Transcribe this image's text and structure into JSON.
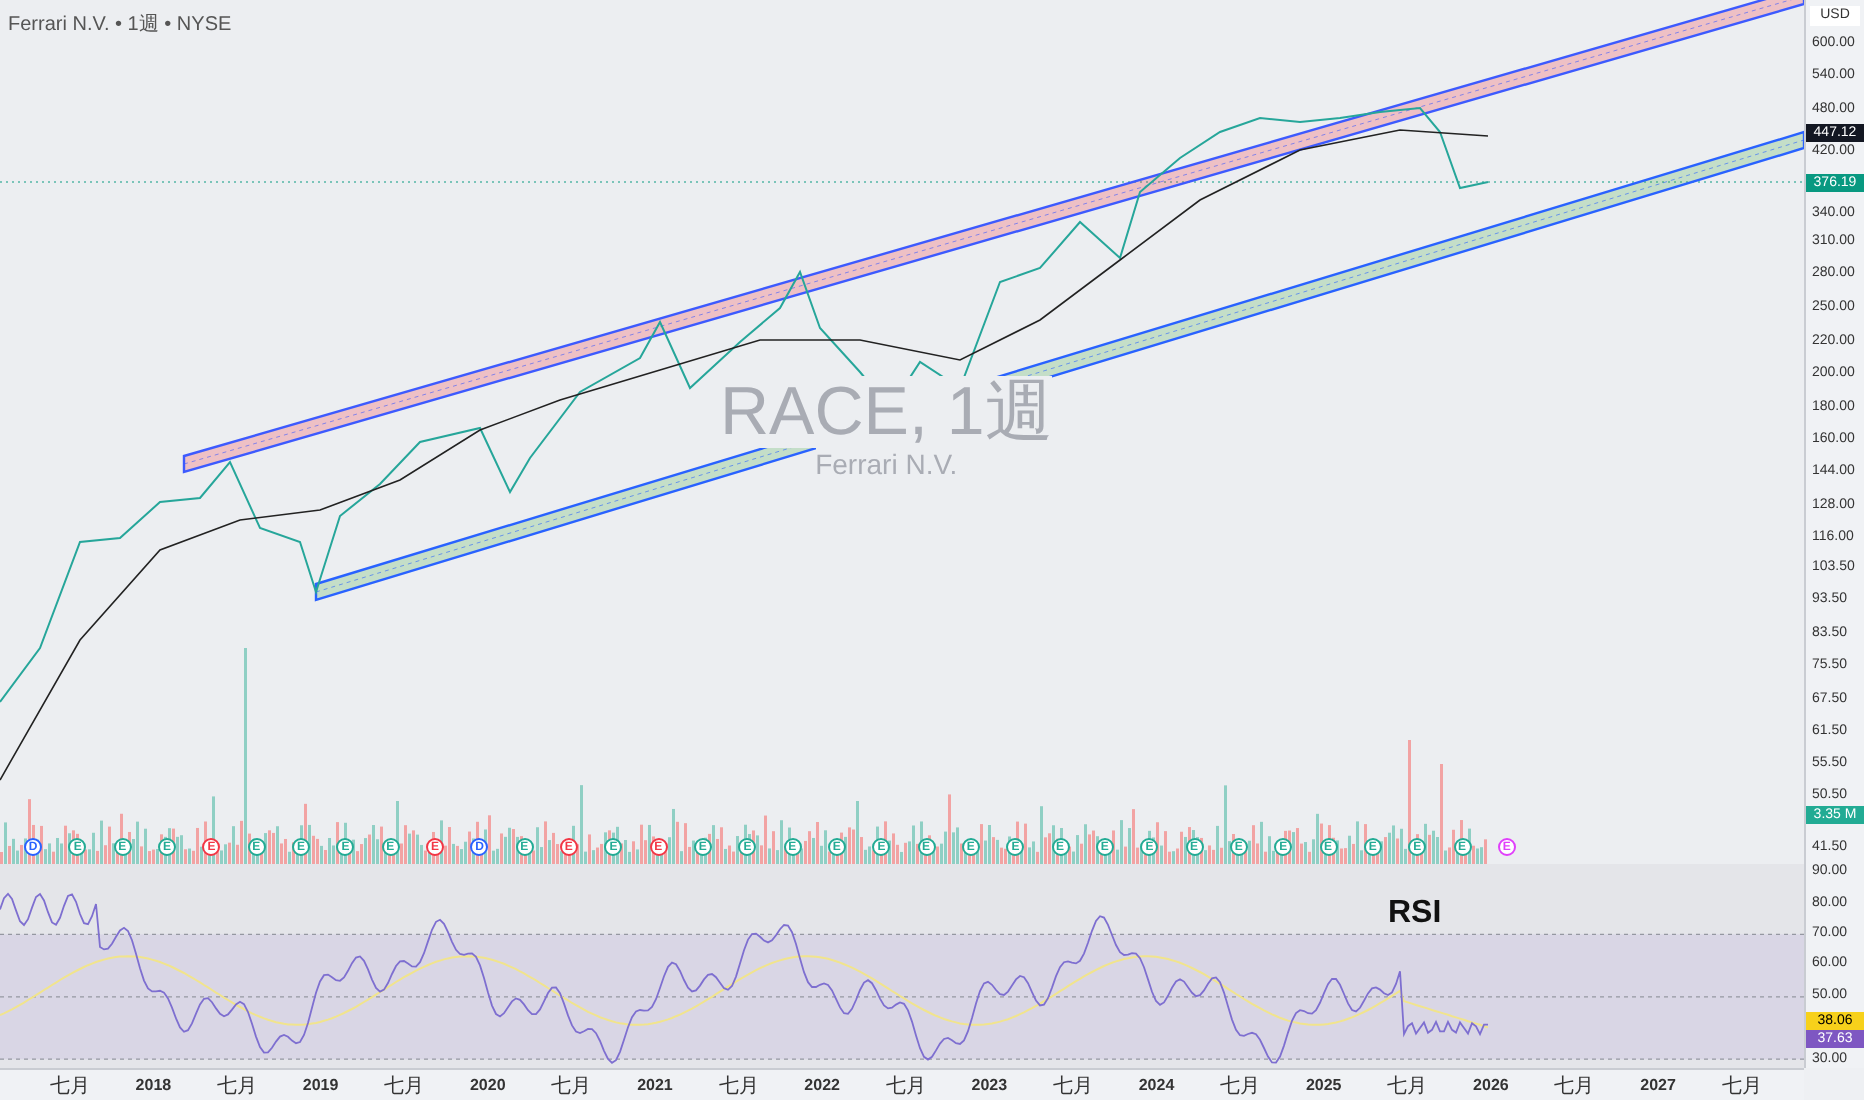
{
  "header": {
    "title": "Ferrari N.V. • 1週 • NYSE"
  },
  "watermark": {
    "symbol": "RACE, 1週",
    "name": "Ferrari N.V."
  },
  "price_axis": {
    "currency": "USD",
    "labels": [
      "600.00",
      "540.00",
      "480.00",
      "420.00",
      "340.00",
      "310.00",
      "280.00",
      "250.00",
      "220.00",
      "200.00",
      "180.00",
      "160.00",
      "144.00",
      "128.00",
      "116.00",
      "103.50",
      "93.50",
      "83.50",
      "75.50",
      "67.50",
      "61.50",
      "55.50",
      "50.50",
      "41.50"
    ],
    "badges": [
      {
        "text": "447.12",
        "color": "#131722"
      },
      {
        "text": "376.19",
        "color": "#089981"
      },
      {
        "text": "3.35 M",
        "color": "#22ab94"
      }
    ]
  },
  "events": [
    {
      "label": "D",
      "color": "#2962ff"
    },
    {
      "label": "E",
      "color": "#22ab94"
    },
    {
      "label": "E",
      "color": "#22ab94"
    },
    {
      "label": "E",
      "color": "#22ab94"
    },
    {
      "label": "E",
      "color": "#f23645"
    },
    {
      "label": "E",
      "color": "#22ab94"
    },
    {
      "label": "E",
      "color": "#22ab94"
    },
    {
      "label": "E",
      "color": "#22ab94"
    },
    {
      "label": "E",
      "color": "#22ab94"
    },
    {
      "label": "E",
      "color": "#f23645"
    },
    {
      "label": "D",
      "color": "#2962ff"
    },
    {
      "label": "E",
      "color": "#22ab94"
    },
    {
      "label": "E",
      "color": "#f23645"
    },
    {
      "label": "E",
      "color": "#22ab94"
    },
    {
      "label": "E",
      "color": "#f23645"
    },
    {
      "label": "E",
      "color": "#22ab94"
    },
    {
      "label": "E",
      "color": "#22ab94"
    },
    {
      "label": "E",
      "color": "#22ab94"
    },
    {
      "label": "E",
      "color": "#22ab94"
    },
    {
      "label": "E",
      "color": "#22ab94"
    },
    {
      "label": "E",
      "color": "#22ab94"
    },
    {
      "label": "E",
      "color": "#22ab94"
    },
    {
      "label": "E",
      "color": "#22ab94"
    },
    {
      "label": "E",
      "color": "#22ab94"
    },
    {
      "label": "E",
      "color": "#22ab94"
    },
    {
      "label": "E",
      "color": "#22ab94"
    },
    {
      "label": "E",
      "color": "#22ab94"
    },
    {
      "label": "E",
      "color": "#22ab94"
    },
    {
      "label": "E",
      "color": "#22ab94"
    },
    {
      "label": "E",
      "color": "#22ab94"
    },
    {
      "label": "E",
      "color": "#22ab94"
    },
    {
      "label": "E",
      "color": "#22ab94"
    },
    {
      "label": "E",
      "color": "#22ab94"
    },
    {
      "label": "E",
      "color": "#e040fb"
    }
  ],
  "rsi": {
    "title": "RSI",
    "labels": [
      "90.00",
      "80.00",
      "70.00",
      "60.00",
      "50.00",
      "30.00"
    ],
    "badges": [
      {
        "text": "38.06",
        "color": "#f7d11b"
      },
      {
        "text": "37.63",
        "color": "#7e57c2"
      }
    ]
  },
  "time_axis": [
    "七月",
    "2018",
    "七月",
    "2019",
    "七月",
    "2020",
    "七月",
    "2021",
    "七月",
    "2022",
    "七月",
    "2023",
    "七月",
    "2024",
    "七月",
    "2025",
    "七月",
    "2026",
    "七月",
    "2027",
    "七月"
  ]
}
